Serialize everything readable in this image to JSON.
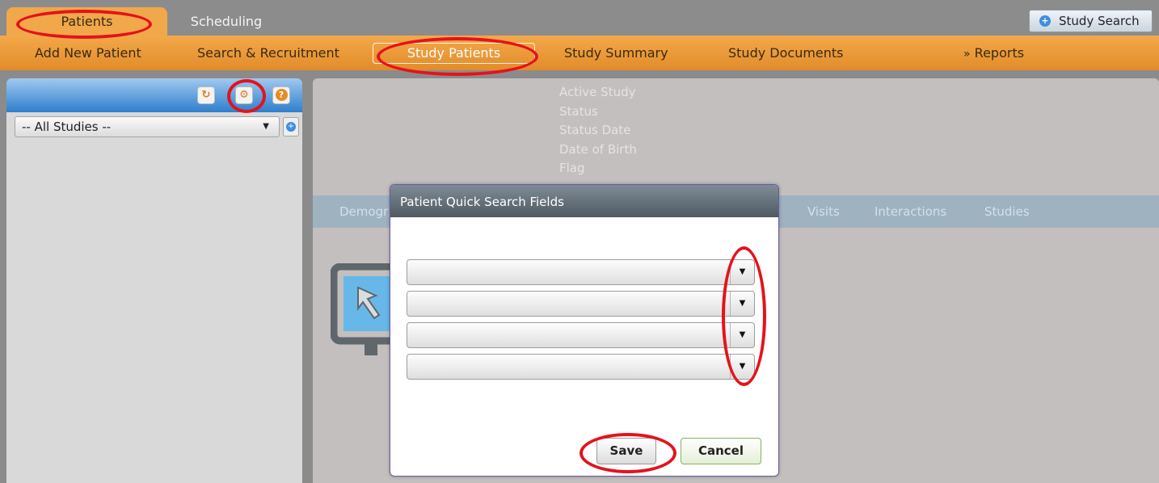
{
  "top_tabs": [
    {
      "label": "Patients"
    },
    {
      "label": "Scheduling"
    }
  ],
  "study_search": {
    "label": "Study Search"
  },
  "nav": {
    "items": [
      "Add New Patient",
      "Search & Recruitment",
      "Study Patients",
      "Study Summary",
      "Study Documents"
    ],
    "reports_label": "Reports"
  },
  "left": {
    "studies_select_value": "-- All Studies --"
  },
  "summary_labels": [
    "Active Study",
    "Status",
    "Status Date",
    "Date of Birth",
    "Flag"
  ],
  "detail_tabs": [
    "Demogr",
    "Visits",
    "Interactions",
    "Studies"
  ],
  "modal": {
    "title": "Patient Quick Search Fields",
    "save_label": "Save",
    "cancel_label": "Cancel"
  },
  "colors": {
    "accent": "#f0a84a",
    "highlight": "#e5121b",
    "header_blue": "#2e7fcd"
  },
  "icons": [
    "refresh-icon",
    "settings-icon",
    "help-icon",
    "add-icon",
    "chevron-down-icon",
    "monitor-icon"
  ]
}
